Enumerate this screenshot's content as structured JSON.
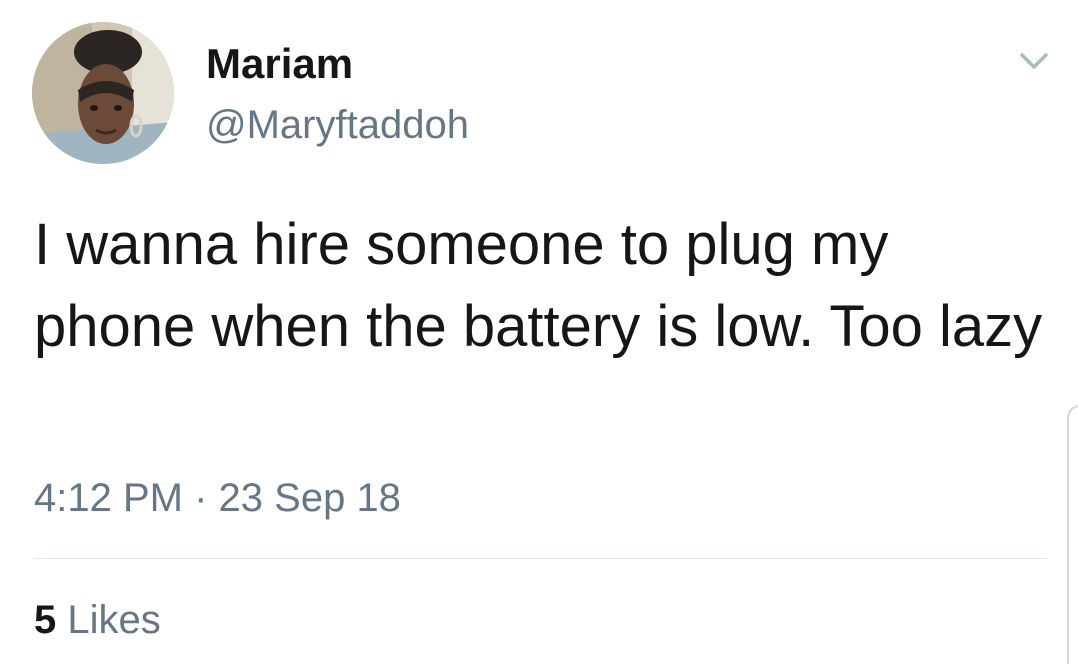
{
  "user": {
    "display_name": "Mariam",
    "handle": "@Maryftaddoh"
  },
  "tweet": {
    "text": "I wanna hire someone to plug my phone when the battery is low. Too lazy",
    "time": "4:12 PM",
    "separator": "·",
    "date": "23 Sep 18"
  },
  "stats": {
    "likes_count": "5",
    "likes_label": "Likes"
  },
  "icons": {
    "menu": "chevron-down-icon"
  },
  "colors": {
    "primary_text": "#14171a",
    "secondary_text": "#657786",
    "divider": "#e1e8ed",
    "caret": "#aab8c2"
  }
}
